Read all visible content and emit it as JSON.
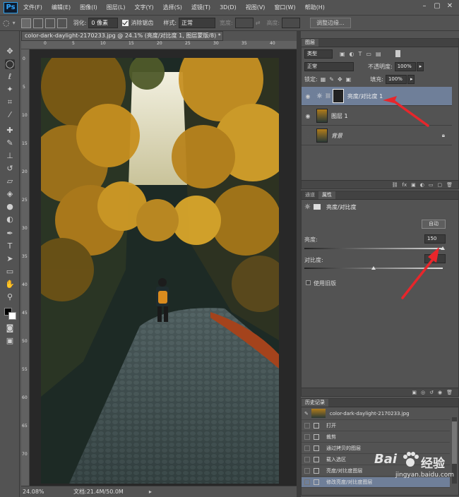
{
  "app": {
    "logo": "Ps"
  },
  "menu": [
    "文件(F)",
    "编辑(E)",
    "图像(I)",
    "图层(L)",
    "文字(Y)",
    "选择(S)",
    "滤镜(T)",
    "3D(D)",
    "视图(V)",
    "窗口(W)",
    "帮助(H)"
  ],
  "options_bar": {
    "feather_label": "羽化:",
    "feather_value": "0 像素",
    "antialias_label": "消除锯齿",
    "style_label": "样式:",
    "style_value": "正常",
    "width_label": "宽度:",
    "height_label": "高度:",
    "refine_edge_button": "调整边缘..."
  },
  "document": {
    "tab_title": "color-dark-daylight-2170233.jpg @ 24.1% (亮度/对比度 1, 图层蒙版/8) *",
    "ruler_top": [
      "0",
      "5",
      "10",
      "15",
      "20",
      "25",
      "30",
      "35",
      "40"
    ],
    "ruler_left": [
      "0",
      "5",
      "10",
      "15",
      "20",
      "25",
      "30",
      "35",
      "40",
      "45",
      "50",
      "55",
      "60",
      "65",
      "70"
    ],
    "zoom": "24.08%",
    "doc_info": "文档:21.4M/50.0M"
  },
  "layers_panel": {
    "tab": "图层",
    "filter_kind": "类型",
    "blend_mode": "正常",
    "opacity_label": "不透明度:",
    "opacity_value": "100%",
    "lock_label": "锁定:",
    "fill_label": "填充:",
    "fill_value": "100%",
    "layers": [
      {
        "name": "亮度/对比度 1",
        "selected": true
      },
      {
        "name": "图层 1",
        "selected": false
      },
      {
        "name": "背景",
        "selected": false
      }
    ]
  },
  "properties_panel": {
    "tabs": [
      "通道",
      "属性"
    ],
    "title": "亮度/对比度",
    "auto_button": "自动",
    "brightness_label": "亮度:",
    "brightness_value": "150",
    "contrast_label": "对比度:",
    "contrast_value": "",
    "legacy_label": "使用旧版"
  },
  "history_panel": {
    "tab": "历史记录",
    "snapshot": "color-dark-daylight-2170233.jpg",
    "items": [
      "打开",
      "裁剪",
      "通过拷贝的图层",
      "载入选区",
      "亮度/对比度图层",
      "修改亮度/对比度图层"
    ]
  },
  "watermark": {
    "brand": "Bai",
    "brand2": "经验",
    "url": "jingyan.baidu.com"
  },
  "colors": {
    "ui_bg": "#535353",
    "selection": "#6f7f99",
    "arrow": "#e8262b"
  }
}
